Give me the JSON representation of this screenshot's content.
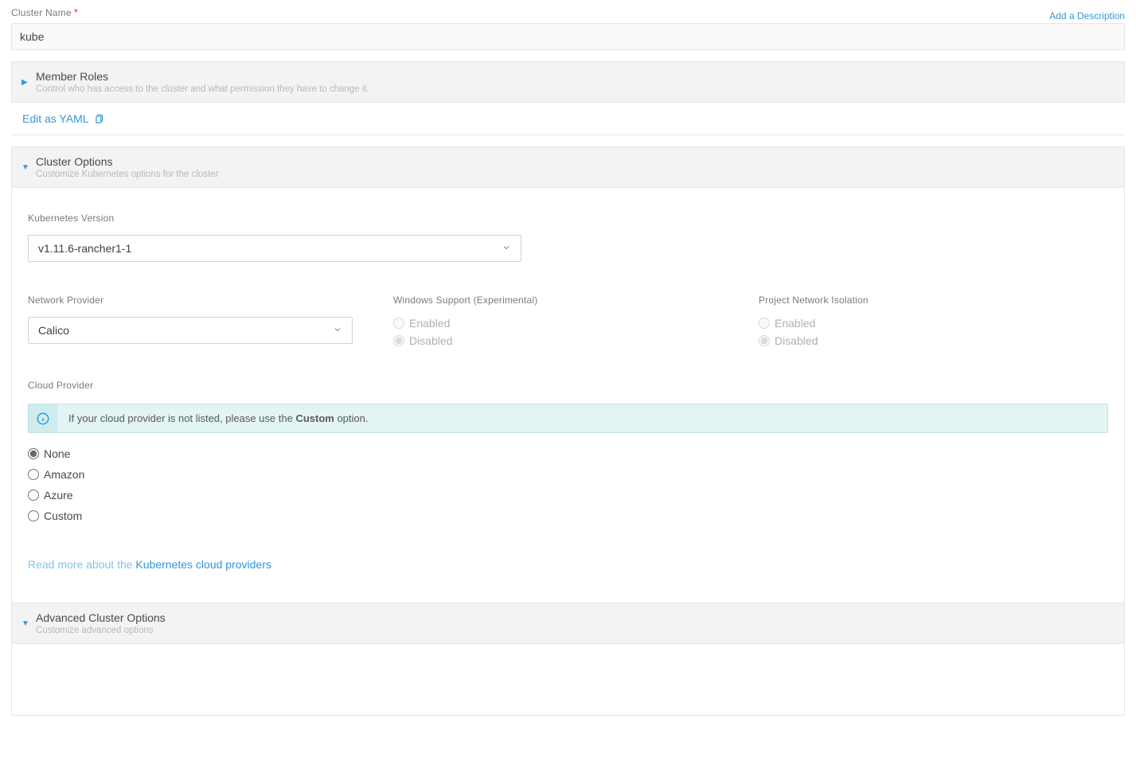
{
  "cluster_name": {
    "label": "Cluster Name",
    "value": "kube"
  },
  "add_desc": "Add a Description",
  "member_roles": {
    "title": "Member Roles",
    "sub": "Control who has access to the cluster and what permission they have to change it."
  },
  "edit_yaml": "Edit as YAML",
  "cluster_options": {
    "title": "Cluster Options",
    "sub": "Customize Kubernetes options for the cluster"
  },
  "k8s_version": {
    "label": "Kubernetes Version",
    "value": "v1.11.6-rancher1-1"
  },
  "network_provider": {
    "label": "Network Provider",
    "value": "Calico"
  },
  "windows_support": {
    "label": "Windows Support (Experimental)",
    "enabled": "Enabled",
    "disabled": "Disabled",
    "value": "disabled"
  },
  "project_isolation": {
    "label": "Project Network Isolation",
    "enabled": "Enabled",
    "disabled": "Disabled",
    "value": "disabled"
  },
  "cloud_provider": {
    "label": "Cloud Provider",
    "info_prefix": "If your cloud provider is not listed, please use the ",
    "info_bold": "Custom",
    "info_suffix": " option.",
    "options": {
      "none": "None",
      "amazon": "Amazon",
      "azure": "Azure",
      "custom": "Custom"
    },
    "value": "none",
    "read_more_prefix": "Read more about the ",
    "read_more_link": "Kubernetes cloud providers"
  },
  "advanced": {
    "title": "Advanced Cluster Options",
    "sub": "Customize advanced options"
  }
}
